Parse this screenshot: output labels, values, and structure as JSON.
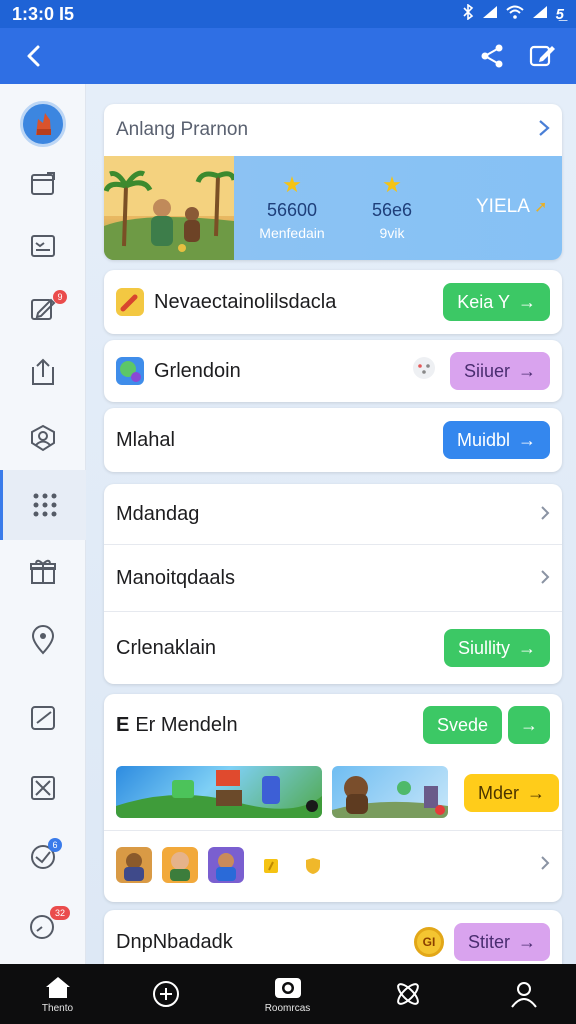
{
  "status_bar": {
    "time": "1:3:0 I5",
    "battery_text": "5̲̲̲"
  },
  "app_bar": {
    "back_icon": "arrow-left-icon",
    "share_icon": "share-icon",
    "edit_icon": "edit-icon"
  },
  "rail": {
    "items": [
      {
        "name": "avatar"
      },
      {
        "icon": "window-icon"
      },
      {
        "icon": "id-card-icon"
      },
      {
        "icon": "compose-icon",
        "badge": "9"
      },
      {
        "icon": "upload-icon"
      },
      {
        "icon": "profile-shield-icon"
      },
      {
        "icon": "grid-icon",
        "active": true
      },
      {
        "icon": "gift-icon"
      },
      {
        "icon": "location-icon"
      },
      {
        "icon": "check-square-icon"
      },
      {
        "icon": "mail-x-icon"
      },
      {
        "icon": "globe-icon",
        "badge": "6"
      },
      {
        "icon": "timer-icon",
        "badge": "32"
      }
    ]
  },
  "header_card": {
    "title": "Anlang Prarnon",
    "stat1_value": "56600",
    "stat1_sub": "Menfedain",
    "stat2_value": "56e6",
    "stat2_sub": "9vik",
    "cta": "YIELA"
  },
  "rows": [
    {
      "label": "Nevaectainolilsdacla",
      "button": "Keia Y"
    },
    {
      "label": "Grlendoin",
      "button": "Siiuer"
    },
    {
      "label": "Mlahal",
      "button": "Muidbl"
    }
  ],
  "menu_card": {
    "items": [
      {
        "label": "Mdandag"
      },
      {
        "label": "Manoitqdaals"
      },
      {
        "label": "Crlenaklain",
        "button": "Siullity"
      }
    ]
  },
  "game_card": {
    "title": "Er Mendeln",
    "button": "Svede",
    "thumb_button": "Mder"
  },
  "last_row": {
    "label": "DnpNbadadk",
    "badge": "GI",
    "button": "Stiter"
  },
  "bottom_nav": {
    "items": [
      {
        "icon": "home-icon",
        "label": "Thento"
      },
      {
        "icon": "compass-icon",
        "label": ""
      },
      {
        "icon": "camera-icon",
        "label": "Roomrcas"
      },
      {
        "icon": "atom-icon",
        "label": ""
      },
      {
        "icon": "person-icon",
        "label": ""
      }
    ]
  },
  "colors": {
    "primary": "#2f6fe4",
    "green": "#3cc865",
    "blue": "#3487ee",
    "purple": "#d9a3ee",
    "yellow": "#ffcc1a"
  }
}
